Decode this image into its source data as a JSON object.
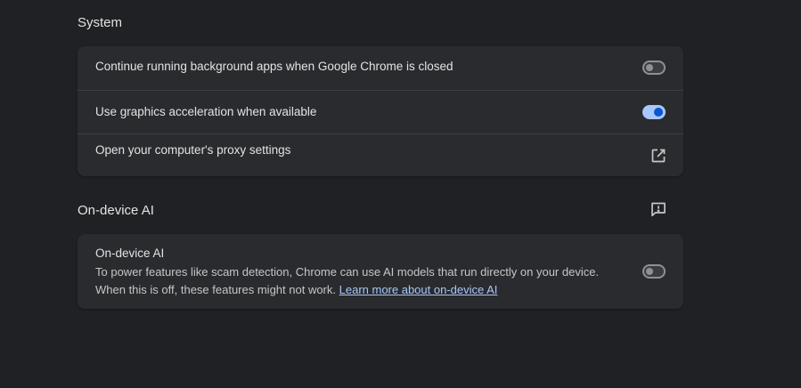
{
  "system_section": {
    "title": "System",
    "items": [
      {
        "label": "Continue running background apps when Google Chrome is closed",
        "toggle": "off"
      },
      {
        "label": "Use graphics acceleration when available",
        "toggle": "on"
      },
      {
        "label": "Open your computer's proxy settings",
        "icon": "open-in-new-icon"
      }
    ]
  },
  "ai_section": {
    "title": "On-device AI",
    "feedback_icon": "feedback-icon",
    "card": {
      "title": "On-device AI",
      "description_line1": "To power features like scam detection, Chrome can use AI models that run directly on your device.",
      "description_line2": "When this is off, these features might not work.",
      "link_text": "Learn more about on-device AI",
      "toggle": "off"
    }
  },
  "colors": {
    "background": "#202124",
    "card": "#2a2b2e",
    "accent": "#a8c7fa",
    "toggle_on_knob": "#0b57d0"
  }
}
